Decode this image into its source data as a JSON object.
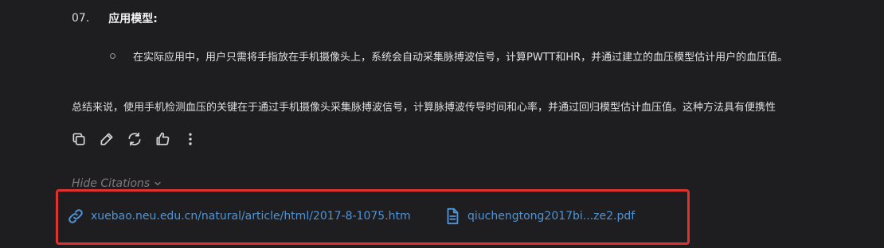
{
  "section": {
    "number": "07.",
    "title": "应用模型:"
  },
  "bullet": {
    "text": "在实际应用中，用户只需将手指放在手机摄像头上，系统会自动采集脉搏波信号，计算PWTT和HR，并通过建立的血压模型估计用户的血压值。"
  },
  "summary": {
    "text": "总结来说，使用手机检测血压的关键在于通过手机摄像头采集脉搏波信号，计算脉搏波传导时间和心率，并通过回归模型估计血压值。这种方法具有便携性"
  },
  "actions": {
    "icons": [
      "copy-icon",
      "edit-icon",
      "regenerate-icon",
      "thumbs-up-icon",
      "more-vertical-icon"
    ]
  },
  "citations": {
    "toggle_label": "Hide Citations",
    "items": [
      {
        "icon": "link-icon",
        "label": "xuebao.neu.edu.cn/natural/article/html/2017-8-1075.htm"
      },
      {
        "icon": "document-icon",
        "label": "qiuchengtong2017bi...ze2.pdf"
      }
    ]
  },
  "colors": {
    "background": "#1e1e20",
    "link": "#4f94d6",
    "highlight_border": "#e03030",
    "muted": "#7b7b80"
  }
}
